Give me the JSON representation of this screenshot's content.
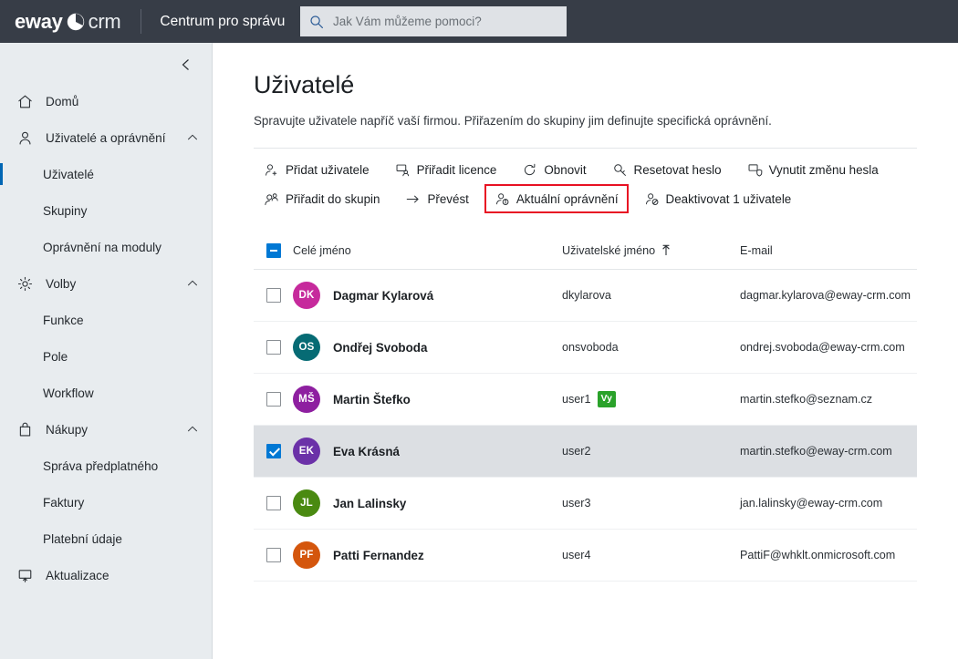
{
  "topbar": {
    "logo_left": "eway",
    "logo_right": "crm",
    "logo_mark_icon": "eway-circle-logo-icon",
    "app_title": "Centrum pro správu",
    "search": {
      "placeholder": "Jak Vám můžeme pomoci?",
      "value": "",
      "icon": "search-icon"
    }
  },
  "sidebar": {
    "collapse_icon": "chevron-left-icon",
    "items": [
      {
        "label": "Domů",
        "icon": "home-icon",
        "level": "top",
        "expandable": false,
        "active": false
      },
      {
        "label": "Uživatelé a oprávnění",
        "icon": "user-icon",
        "level": "top",
        "expandable": true,
        "expanded": true,
        "active": false
      },
      {
        "label": "Uživatelé",
        "icon": "",
        "level": "sub",
        "expandable": false,
        "active": true
      },
      {
        "label": "Skupiny",
        "icon": "",
        "level": "sub",
        "expandable": false,
        "active": false
      },
      {
        "label": "Oprávnění na moduly",
        "icon": "",
        "level": "sub",
        "expandable": false,
        "active": false
      },
      {
        "label": "Volby",
        "icon": "gear-icon",
        "level": "top",
        "expandable": true,
        "expanded": true,
        "active": false
      },
      {
        "label": "Funkce",
        "icon": "",
        "level": "sub",
        "expandable": false,
        "active": false
      },
      {
        "label": "Pole",
        "icon": "",
        "level": "sub",
        "expandable": false,
        "active": false
      },
      {
        "label": "Workflow",
        "icon": "",
        "level": "sub",
        "expandable": false,
        "active": false
      },
      {
        "label": "Nákupy",
        "icon": "bag-icon",
        "level": "top",
        "expandable": true,
        "expanded": true,
        "active": false
      },
      {
        "label": "Správa předplatného",
        "icon": "",
        "level": "sub",
        "expandable": false,
        "active": false
      },
      {
        "label": "Faktury",
        "icon": "",
        "level": "sub",
        "expandable": false,
        "active": false
      },
      {
        "label": "Platební údaje",
        "icon": "",
        "level": "sub",
        "expandable": false,
        "active": false
      },
      {
        "label": "Aktualizace",
        "icon": "update-icon",
        "level": "top",
        "expandable": false,
        "active": false
      }
    ]
  },
  "page": {
    "title": "Uživatelé",
    "subtitle": "Spravujte uživatele napříč vaší firmou. Přiřazením do skupiny jim definujte specifická oprávnění."
  },
  "toolbar": {
    "highlight_color": "#e81123",
    "rows": [
      [
        {
          "label": "Přidat uživatele",
          "icon": "user-add-icon",
          "highlighted": false
        },
        {
          "label": "Přiřadit licence",
          "icon": "license-user-icon",
          "highlighted": false
        },
        {
          "label": "Obnovit",
          "icon": "refresh-icon",
          "highlighted": false
        },
        {
          "label": "Resetovat heslo",
          "icon": "key-icon",
          "highlighted": false
        },
        {
          "label": "Vynutit změnu hesla",
          "icon": "shield-screen-icon",
          "highlighted": false
        }
      ],
      [
        {
          "label": "Přiřadit do skupin",
          "icon": "user-group-icon",
          "highlighted": false
        },
        {
          "label": "Převést",
          "icon": "arrow-right-icon",
          "highlighted": false
        },
        {
          "label": "Aktuální oprávnění",
          "icon": "user-info-icon",
          "highlighted": true
        },
        {
          "label": "Deaktivovat 1 uživatele",
          "icon": "user-block-icon",
          "highlighted": false
        }
      ]
    ]
  },
  "table": {
    "select_all_state": "indeterminate",
    "columns": [
      {
        "key": "fullname",
        "label": "Celé jméno",
        "sorted": false
      },
      {
        "key": "username",
        "label": "Uživatelské jméno",
        "sorted": true,
        "sort_direction": "asc"
      },
      {
        "key": "email",
        "label": "E-mail",
        "sorted": false
      }
    ],
    "rows": [
      {
        "checked": false,
        "selected": false,
        "initials": "DK",
        "avatar_color": "#c62a9c",
        "fullname": "Dagmar Kylarová",
        "username": "dkylarova",
        "badge": "",
        "email": "dagmar.kylarova@eway-crm.com"
      },
      {
        "checked": false,
        "selected": false,
        "initials": "OS",
        "avatar_color": "#066b74",
        "fullname": "Ondřej Svoboda",
        "username": "onsvoboda",
        "badge": "",
        "email": "ondrej.svoboda@eway-crm.com"
      },
      {
        "checked": false,
        "selected": false,
        "initials": "MŠ",
        "avatar_color": "#8e1fa0",
        "fullname": "Martin Štefko",
        "username": "user1",
        "badge": "Vy",
        "email": "martin.stefko@seznam.cz"
      },
      {
        "checked": true,
        "selected": true,
        "initials": "EK",
        "avatar_color": "#6b31a8",
        "fullname": "Eva Krásná",
        "username": "user2",
        "badge": "",
        "email": "martin.stefko@eway-crm.com"
      },
      {
        "checked": false,
        "selected": false,
        "initials": "JL",
        "avatar_color": "#4a8a11",
        "fullname": "Jan Lalinsky",
        "username": "user3",
        "badge": "",
        "email": "jan.lalinsky@eway-crm.com"
      },
      {
        "checked": false,
        "selected": false,
        "initials": "PF",
        "avatar_color": "#d4560d",
        "fullname": "Patti Fernandez",
        "username": "user4",
        "badge": "",
        "email": "PattiF@whklt.onmicrosoft.com"
      }
    ]
  }
}
